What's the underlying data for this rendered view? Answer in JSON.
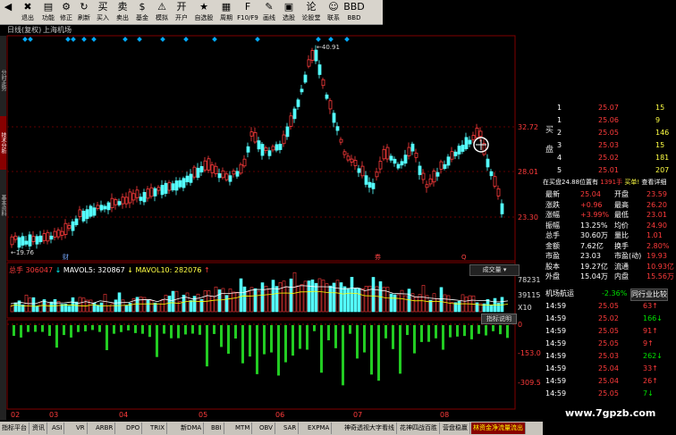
{
  "toolbar": {
    "buttons": [
      {
        "icon": "◀",
        "label": ""
      },
      {
        "icon": "✖",
        "label": "退出"
      },
      {
        "icon": "▤",
        "label": "功能"
      },
      {
        "icon": "⚙",
        "label": "修正"
      },
      {
        "icon": "↻",
        "label": "刷新"
      },
      {
        "icon": "买",
        "label": "买入"
      },
      {
        "icon": "卖",
        "label": "卖出"
      },
      {
        "icon": "$",
        "label": "基金"
      },
      {
        "icon": "⚠",
        "label": "模拟"
      },
      {
        "icon": "开",
        "label": "开户"
      },
      {
        "icon": "★",
        "label": "自选股"
      },
      {
        "icon": "▦",
        "label": "周期"
      },
      {
        "icon": "F",
        "label": "F10/F9"
      },
      {
        "icon": "✎",
        "label": "画线"
      },
      {
        "icon": "▣",
        "label": "选股"
      },
      {
        "icon": "论",
        "label": "论股堂"
      },
      {
        "icon": "☺",
        "label": "联系"
      },
      {
        "icon": "BBD",
        "label": "BBD"
      }
    ]
  },
  "title": {
    "period": "日线(复权)",
    "name": "上海机场"
  },
  "left_strip": [
    "分时走势",
    "技术分析",
    "基本资料"
  ],
  "price_labels": {
    "high": "40.91",
    "low": "19.76",
    "p1": "32.72",
    "p2": "28.01",
    "p3": "23.30"
  },
  "markers": {
    "m1": "财",
    "m2": "券",
    "m3": "Q"
  },
  "volume_header": {
    "total_label": "总手",
    "total": "306047",
    "ma5_label": "MAVOL5:",
    "ma5": "320867",
    "ma10_label": "MAVOL10:",
    "ma10": "282076",
    "button": "成交量"
  },
  "volume_labels": {
    "v1": "78231",
    "v2": "39115",
    "v3": "X10"
  },
  "indicator": {
    "button": "指标说明",
    "l0": "0",
    "l1": "-153.0",
    "l2": "-309.5"
  },
  "x_labels": [
    "02",
    "03",
    "04",
    "05",
    "06",
    "07",
    "08"
  ],
  "orderbook": {
    "side_buy": "买盘",
    "rows": [
      {
        "lvl": "1",
        "price": "25.07",
        "vol": "15"
      },
      {
        "lvl": "1",
        "price": "25.06",
        "vol": "9"
      },
      {
        "lvl": "2",
        "price": "25.05",
        "vol": "146"
      },
      {
        "lvl": "3",
        "price": "25.03",
        "vol": "15"
      },
      {
        "lvl": "4",
        "price": "25.02",
        "vol": "181"
      },
      {
        "lvl": "5",
        "price": "25.01",
        "vol": "207"
      }
    ],
    "buyinfo": "在买盘24.88位置有",
    "buyqty": "1391手",
    "buybtn": "买单!",
    "detail": "查看详细"
  },
  "quote": [
    {
      "k1": "最新",
      "v1": "25.04",
      "k2": "开盘",
      "v2": "23.59"
    },
    {
      "k1": "涨跌",
      "v1": "+0.96",
      "k2": "最高",
      "v2": "26.20"
    },
    {
      "k1": "涨幅",
      "v1": "+3.99%",
      "k2": "最低",
      "v2": "23.01"
    },
    {
      "k1": "振幅",
      "v1": "13.25%",
      "k2": "均价",
      "v2": "24.90"
    },
    {
      "k1": "总手",
      "v1": "30.60万",
      "k2": "量比",
      "v2": "1.01"
    },
    {
      "k1": "金额",
      "v1": "7.62亿",
      "k2": "换手",
      "v2": "2.80%"
    },
    {
      "k1": "市盈",
      "v1": "23.03",
      "k2": "市盈(动)",
      "v2": "19.93"
    },
    {
      "k1": "股本",
      "v1": "19.27亿",
      "k2": "流通",
      "v2": "10.93亿"
    },
    {
      "k1": "外盘",
      "v1": "15.04万",
      "k2": "内盘",
      "v2": "15.56万"
    }
  ],
  "sector": {
    "name": "机场航运",
    "change": "-2.36%",
    "btn": "同行业比较"
  },
  "ticks": [
    {
      "t": "14:59",
      "p": "25.05",
      "v": "63"
    },
    {
      "t": "14:59",
      "p": "25.02",
      "v": "166"
    },
    {
      "t": "14:59",
      "p": "25.05",
      "v": "91"
    },
    {
      "t": "14:59",
      "p": "25.05",
      "v": "9"
    },
    {
      "t": "14:59",
      "p": "25.03",
      "v": "262"
    },
    {
      "t": "14:59",
      "p": "25.04",
      "v": "33"
    },
    {
      "t": "14:59",
      "p": "25.04",
      "v": "26"
    },
    {
      "t": "14:59",
      "p": "25.05",
      "v": "7"
    }
  ],
  "tabs": [
    "指标平台",
    "资讯",
    "ASI",
    "VR",
    "ARBR",
    "DPO",
    "TRIX",
    "新DMA",
    "BBI",
    "MTM",
    "OBV",
    "SAR",
    "EXPMA",
    "神奇透视大字看线",
    "花神四战百胜",
    "营盘稳赢",
    "林资金净流量流出"
  ],
  "watermark": "www.7gpzb.com",
  "colors": {
    "up": "#ff3b3b",
    "down": "#54ffff",
    "vol_neg": "#22cc22",
    "ma5": "#ffffff",
    "ma10": "#ffff00"
  }
}
